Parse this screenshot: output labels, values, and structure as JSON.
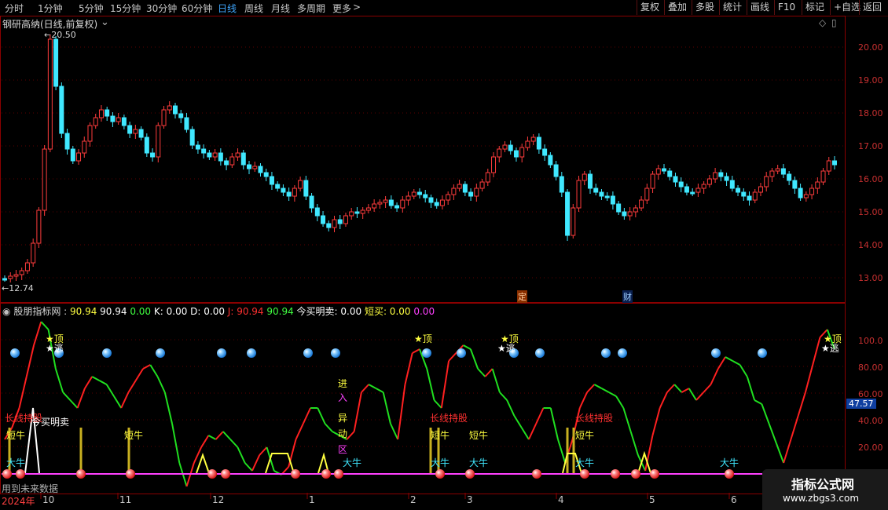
{
  "toolbar": {
    "timeframes": [
      "分时",
      "1分钟",
      "5分钟",
      "15分钟",
      "30分钟",
      "60分钟",
      "日线",
      "周线",
      "月线",
      "多周期",
      "更多"
    ],
    "active_timeframe": "日线",
    "right_buttons": [
      "复权",
      "叠加",
      "多股",
      "统计",
      "画线",
      "F10",
      "标记",
      "+自选",
      "返回"
    ]
  },
  "main_chart": {
    "title": "钢研高纳(日线,前复权)",
    "high_label": "20.50",
    "low_label": "12.74",
    "y_ticks": [
      "20.00",
      "19.00",
      "18.00",
      "17.00",
      "16.00",
      "15.00",
      "14.00",
      "13.00"
    ],
    "event_markers": [
      "定",
      "财"
    ]
  },
  "indicator": {
    "name": "股朋指标网",
    "values": [
      {
        "text": "90.94",
        "color": "#ffff40"
      },
      {
        "text": "90.94",
        "color": "#ffffff"
      },
      {
        "text": "0.00",
        "color": "#40ff40"
      },
      {
        "text": "K: 0.00",
        "color": "#ffffff"
      },
      {
        "text": "D: 0.00",
        "color": "#ffffff"
      },
      {
        "text": "J: 90.94",
        "color": "#ff3030"
      },
      {
        "text": "90.94",
        "color": "#40ff40"
      },
      {
        "text": "今买明卖: 0.00",
        "color": "#ffffff"
      },
      {
        "text": "短买: 0.00",
        "color": "#ffff40"
      },
      {
        "text": "0.00",
        "color": "#ff40ff"
      }
    ],
    "y_ticks": [
      "100.0",
      "80.00",
      "60.00",
      "40.00",
      "20.00"
    ],
    "current_value": "47.57",
    "signals": {
      "top": "★顶",
      "escape": "★逃",
      "long_hold": "长线持股",
      "buy_today_sell_tomorrow": "今买明卖",
      "short_bull": "短牛",
      "big_bull": "大牛",
      "enter_chars": [
        "进",
        "入"
      ],
      "abnormal_chars": [
        "异",
        "动",
        "区"
      ]
    },
    "footer_note": "用到未来数据"
  },
  "x_axis": [
    "2024年",
    "10",
    "11",
    "12",
    "1",
    "2",
    "3",
    "4",
    "5",
    "6"
  ],
  "watermark": {
    "title": "指标公式网",
    "url": "www.zbgs3.com"
  },
  "colors": {
    "up": "#ff3c3c",
    "down": "#40e8ff",
    "grid": "#8b0000",
    "rise_line": "#ff2020",
    "fall_line": "#20e020",
    "signal": "#ffff40",
    "active_tab": "#3fa7ff"
  }
}
